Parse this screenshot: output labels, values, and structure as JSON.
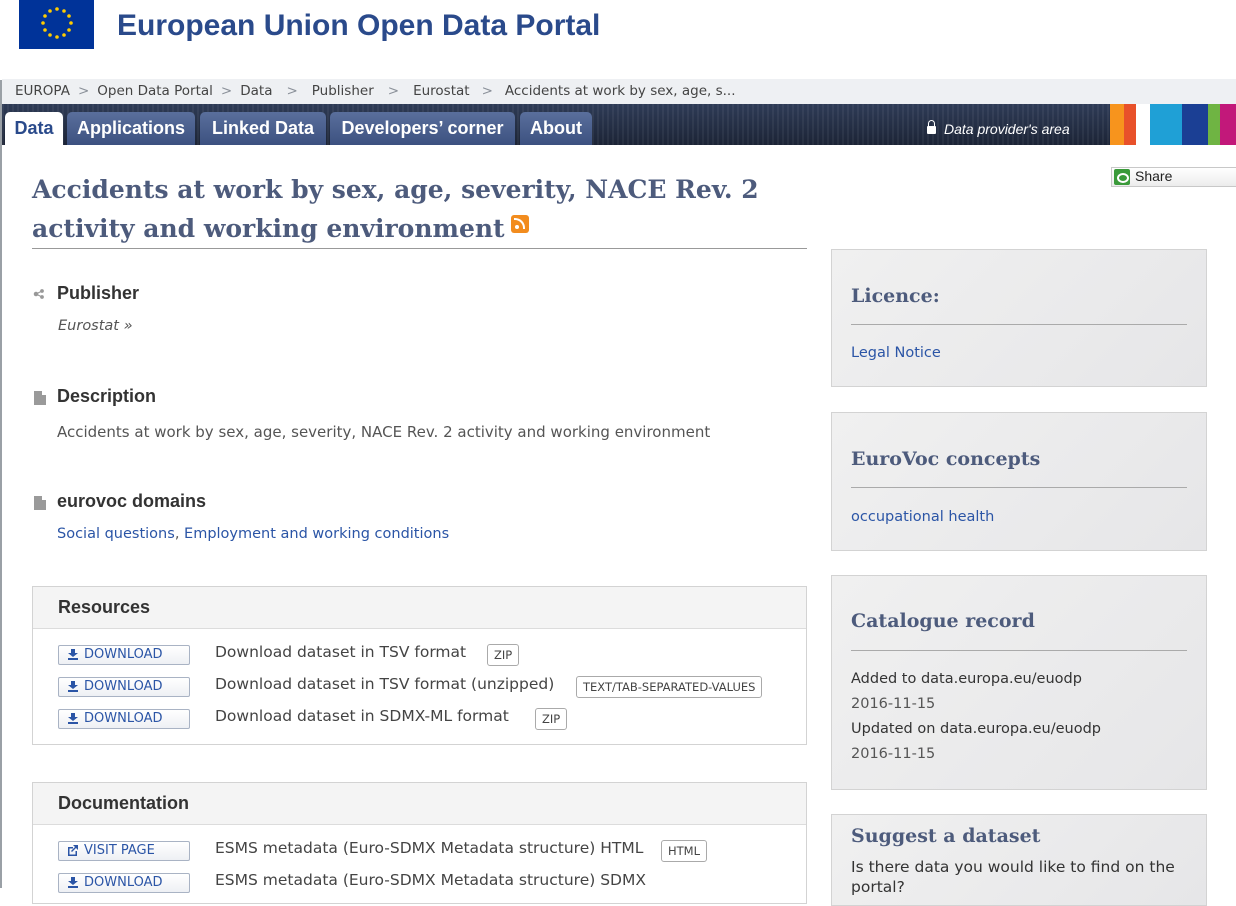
{
  "header": {
    "site_title": "European Union Open Data Portal"
  },
  "breadcrumb": [
    "EUROPA",
    "Open Data Portal",
    "Data",
    "Publisher",
    "Eurostat",
    "Accidents at work by sex, age, s..."
  ],
  "breadcrumb_sep": ">",
  "nav": {
    "tabs": [
      "Data",
      "Applications",
      "Linked Data",
      "Developers’ corner",
      "About"
    ],
    "provider_area": "Data provider's area"
  },
  "share_label": "Share",
  "dataset": {
    "title_line1": "Accidents at work by sex, age, severity, NACE Rev. 2",
    "title_line2": "activity and working environment",
    "publisher_heading": "Publisher",
    "publisher_link": "Eurostat »",
    "description_heading": "Description",
    "description_text": "Accidents at work by sex, age, severity, NACE Rev. 2 activity and working environment",
    "eurovoc_heading": "eurovoc domains",
    "eurovoc_domain_1": "Social questions",
    "eurovoc_comma": ",",
    "eurovoc_domain_2": "Employment and working conditions"
  },
  "resources": {
    "heading": "Resources",
    "rows": [
      {
        "button": "DOWNLOAD",
        "text": "Download dataset in TSV format",
        "format": "ZIP"
      },
      {
        "button": "DOWNLOAD",
        "text": "Download dataset in TSV format (unzipped)",
        "format": "TEXT/TAB-SEPARATED-VALUES"
      },
      {
        "button": "DOWNLOAD",
        "text": "Download dataset in SDMX-ML format",
        "format": "ZIP"
      }
    ]
  },
  "documentation": {
    "heading": "Documentation",
    "rows": [
      {
        "button": "VISIT PAGE",
        "text": "ESMS metadata (Euro-SDMX Metadata structure) HTML",
        "format": "HTML"
      },
      {
        "button": "DOWNLOAD",
        "text": "ESMS metadata (Euro-SDMX Metadata structure) SDMX",
        "format": ""
      }
    ]
  },
  "sidebar": {
    "licence": {
      "heading": "Licence:",
      "link": "Legal Notice"
    },
    "eurovoc": {
      "heading": "EuroVoc concepts",
      "link": "occupational health"
    },
    "catalogue": {
      "heading": "Catalogue record",
      "added_label": "Added to data.europa.eu/euodp",
      "added_date": "2016-11-15",
      "updated_label": "Updated on data.europa.eu/euodp",
      "updated_date": "2016-11-15"
    },
    "suggest": {
      "heading": "Suggest a dataset",
      "text_line1": "Is there data you would like to find on the",
      "text_line2": "portal?"
    }
  },
  "colors": {
    "brand_blue": "#003399",
    "nav_dark": "#1c2436",
    "title": "#4d5b7c",
    "link": "#2b55a6"
  }
}
